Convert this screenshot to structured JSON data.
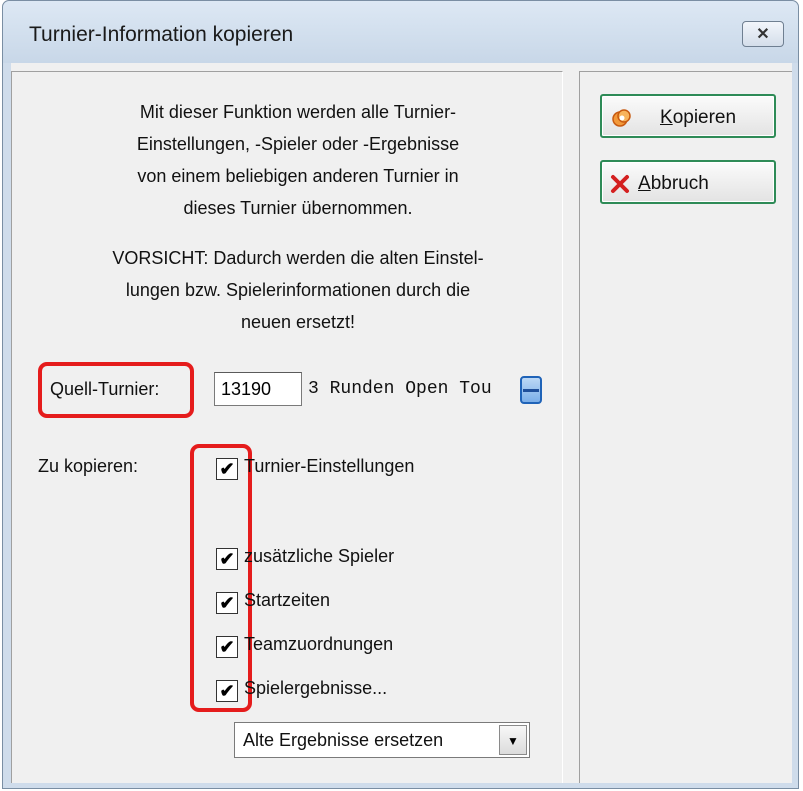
{
  "window": {
    "title": "Turnier-Information kopieren"
  },
  "info": {
    "lines1": [
      "Mit dieser Funktion werden alle Turnier-",
      "Einstellungen, -Spieler oder -Ergebnisse",
      "von einem beliebigen anderen Turnier in",
      "dieses Turnier übernommen."
    ],
    "lines2": [
      "VORSICHT: Dadurch werden die alten Einstel-",
      "lungen bzw. Spielerinformationen durch die",
      "neuen ersetzt!"
    ]
  },
  "source": {
    "label": "Quell-Turnier:",
    "id_value": "13190",
    "name": "3 Runden Open Tou"
  },
  "copy": {
    "label": "Zu kopieren:",
    "options": [
      {
        "label": "Turnier-Einstellungen",
        "checked": true
      },
      {
        "label": "zusätzliche Spieler",
        "checked": true
      },
      {
        "label": "Startzeiten",
        "checked": true
      },
      {
        "label": "Teamzuordnungen",
        "checked": true
      },
      {
        "label": "Spielergebnisse...",
        "checked": true
      }
    ],
    "results_mode": "Alte Ergebnisse ersetzen"
  },
  "buttons": {
    "copy_access_key": "K",
    "copy_rest": "opieren",
    "abort_access_key": "A",
    "abort_rest": "bbruch"
  },
  "colors": {
    "highlight": "#e51c1c",
    "button_border": "#2e8b57"
  }
}
